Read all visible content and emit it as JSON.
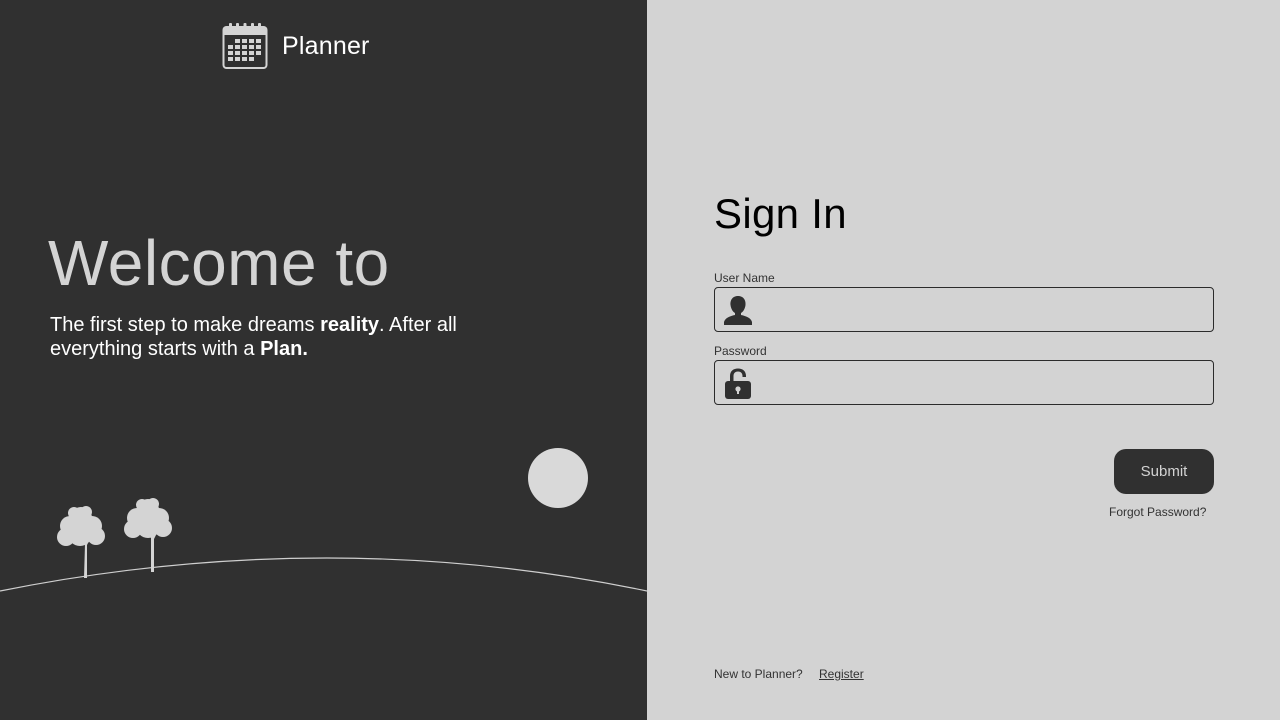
{
  "brand": {
    "name": "Planner",
    "icon": "calendar-icon"
  },
  "hero": {
    "heading": "Welcome to",
    "tagline_part1": "The first step to make dreams ",
    "tagline_bold1": "reality",
    "tagline_part2": ". After all everything starts with a ",
    "tagline_bold2": "Plan."
  },
  "signin": {
    "title": "Sign In",
    "username_label": "User Name",
    "username_value": "",
    "username_icon": "user-icon",
    "password_label": "Password",
    "password_value": "",
    "password_icon": "unlock-icon",
    "submit_label": "Submit",
    "forgot_label": "Forgot Password?",
    "new_prompt": "New to Planner?",
    "register_label": "Register"
  },
  "colors": {
    "left_bg": "#303030",
    "right_bg": "#d3d3d3",
    "button_bg": "#303030",
    "accent_light": "#d4d4d4"
  }
}
